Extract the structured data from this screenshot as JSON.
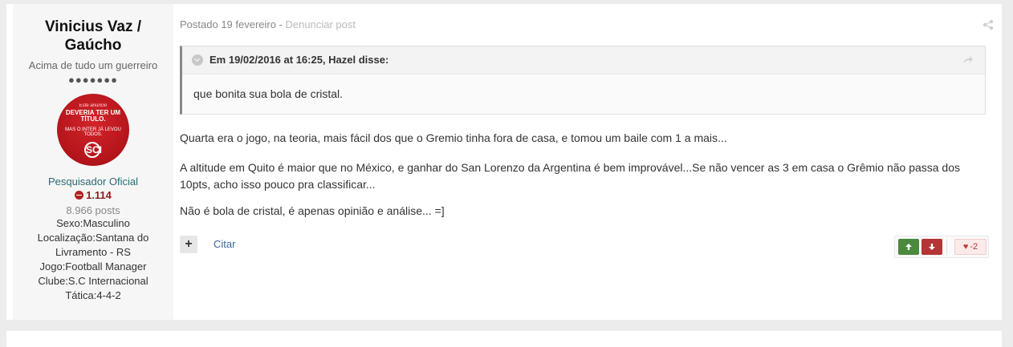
{
  "author": {
    "name": "Vinicius Vaz / Gaúcho",
    "title": "Acima de tudo um guerreiro",
    "rank_pips": "●●●●●●●",
    "avatar_text": {
      "line1": "Este anúncio",
      "line2": "DEVERIA TER UM TÍTULO.",
      "line3": "MAS O INTER JÁ LEVOU TODOS.",
      "crest": "SCI"
    },
    "group": "Pesquisador Oficial",
    "reputation": "1.114",
    "posts": "8.966 posts",
    "fields": [
      "Sexo:Masculino",
      "Localização:Santana do Livramento - RS",
      "Jogo:Football Manager",
      "Clube:S.C Internacional",
      "Tática:4-4-2"
    ]
  },
  "meta": {
    "posted": "Postado 19 fevereiro",
    "separator": " - ",
    "report": "Denunciar post"
  },
  "quote": {
    "header": "Em 19/02/2016 at 16:25, Hazel disse:",
    "body": "que bonita sua bola de cristal."
  },
  "post": {
    "paragraphs": [
      "Quarta era o jogo, na teoria, mais fácil dos que o Gremio tinha fora de casa, e tomou um baile com 1 a mais...",
      "A altitude em Quito é maior que no México, e ganhar do San Lorenzo da Argentina é bem improvável...Se não vencer as 3 em casa o Grêmio não passa dos 10pts, acho isso pouco pra classificar...",
      "Não é bola de cristal, é apenas opinião e análise... =]"
    ]
  },
  "actions": {
    "plus_label": "+",
    "quote_label": "Citar",
    "upvote_icon": "arrow-up-icon",
    "downvote_icon": "arrow-down-icon",
    "score": "-2"
  },
  "colors": {
    "group": "#2a6b71",
    "reputation": "#8b1c1c",
    "upvote": "#4b8a3c",
    "downvote": "#b43535",
    "link": "#3d6594"
  }
}
